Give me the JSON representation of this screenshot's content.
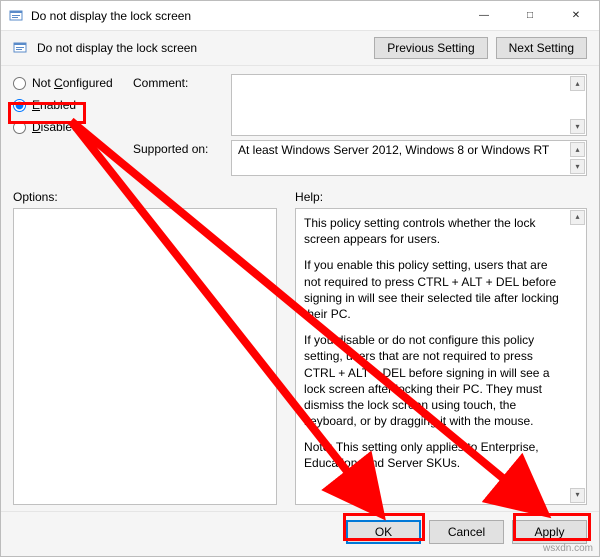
{
  "titlebar": {
    "title": "Do not display the lock screen"
  },
  "header": {
    "title": "Do not display the lock screen",
    "prev_btn": "Previous Setting",
    "next_btn": "Next Setting"
  },
  "config": {
    "radios": {
      "not_configured": "Not Configured",
      "enabled": "Enabled",
      "disabled": "Disabled"
    },
    "comment_label": "Comment:",
    "comment_value": "",
    "supported_label": "Supported on:",
    "supported_value": "At least Windows Server 2012, Windows 8 or Windows RT"
  },
  "main": {
    "options_label": "Options:",
    "help_label": "Help:",
    "help_text": {
      "p1": "This policy setting controls whether the lock screen appears for users.",
      "p2": "If you enable this policy setting, users that are not required to press CTRL + ALT + DEL before signing in will see their selected tile after locking their PC.",
      "p3": "If you disable or do not configure this policy setting, users that are not required to press CTRL + ALT + DEL before signing in will see a lock screen after locking their PC. They must dismiss the lock screen using touch, the keyboard, or by dragging it with the mouse.",
      "p4": "Note: This setting only applies to Enterprise, Education, and Server SKUs."
    }
  },
  "footer": {
    "ok": "OK",
    "cancel": "Cancel",
    "apply": "Apply"
  },
  "watermark": "wsxdn.com"
}
